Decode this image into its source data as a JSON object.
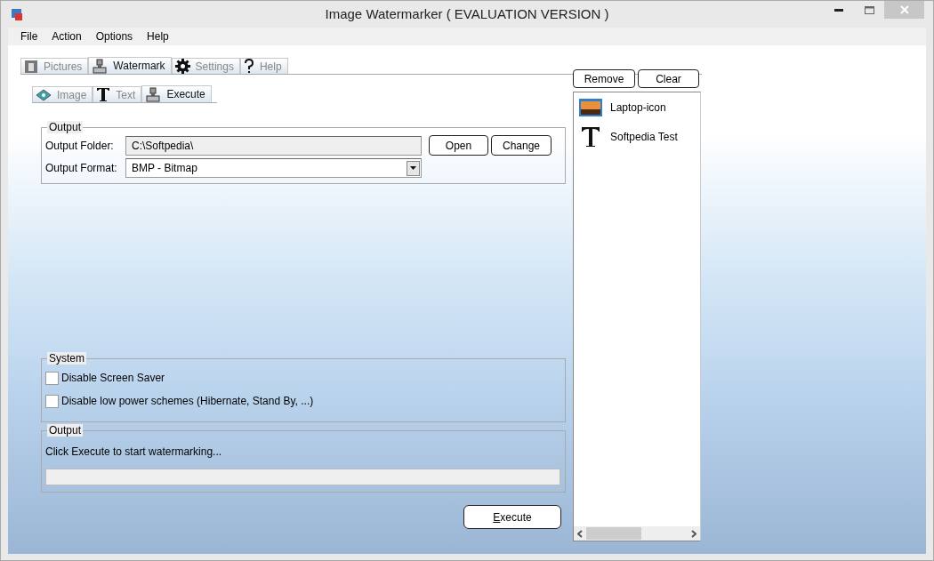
{
  "window": {
    "title": "Image Watermarker ( EVALUATION VERSION )"
  },
  "menu": [
    "File",
    "Action",
    "Options",
    "Help"
  ],
  "tabs": [
    {
      "label": "Pictures",
      "kind": "pictures",
      "selected": false
    },
    {
      "label": "Watermark",
      "kind": "stamp",
      "selected": true
    },
    {
      "label": "Settings",
      "kind": "gear",
      "selected": false
    },
    {
      "label": "Help",
      "kind": "question",
      "selected": false
    }
  ],
  "subtabs": [
    {
      "label": "Image",
      "kind": "image",
      "selected": false
    },
    {
      "label": "Text",
      "kind": "text",
      "selected": false
    },
    {
      "label": "Execute",
      "kind": "stamp",
      "selected": true
    }
  ],
  "output_group": {
    "legend": "Output",
    "folder_label": "Output Folder:",
    "folder_value": "C:\\Softpedia\\",
    "open_button": "Open",
    "change_button": "Change",
    "format_label": "Output Format:",
    "format_value": "BMP - Bitmap"
  },
  "system_group": {
    "legend": "System",
    "options": [
      {
        "label": "Disable Screen Saver",
        "checked": false
      },
      {
        "label": "Disable low power schemes (Hibernate, Stand By, ...)",
        "checked": false
      }
    ]
  },
  "progress_group": {
    "legend": "Output",
    "message": "Click Execute to start watermarking...",
    "level": 0
  },
  "execute_button": "Execute",
  "watermark_list": {
    "remove_button": "Remove",
    "clear_button": "Clear",
    "items": [
      {
        "label": "Laptop-icon",
        "kind": "image",
        "selected": false
      },
      {
        "label": "Softpedia Test",
        "kind": "text",
        "selected": false
      }
    ]
  }
}
